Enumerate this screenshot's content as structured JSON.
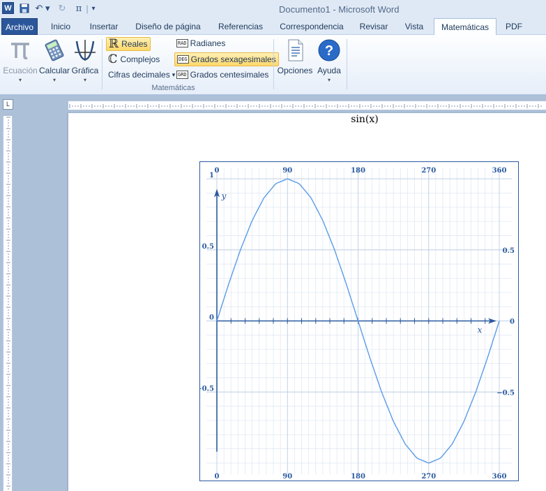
{
  "window": {
    "title": "Documento1  -  Microsoft Word"
  },
  "quick_access": {
    "word_logo": "W",
    "save_icon": "save-icon",
    "undo_glyph": "↶ ▾",
    "redo_glyph": "↻",
    "pi_glyph": "π",
    "separator": "|",
    "customize_glyph": "▾"
  },
  "tabs": [
    {
      "label": "Archivo"
    },
    {
      "label": "Inicio"
    },
    {
      "label": "Insertar"
    },
    {
      "label": "Diseño de página"
    },
    {
      "label": "Referencias"
    },
    {
      "label": "Correspondencia"
    },
    {
      "label": "Revisar"
    },
    {
      "label": "Vista"
    },
    {
      "label": "Matemáticas"
    },
    {
      "label": "PDF"
    }
  ],
  "ribbon": {
    "ecuacion": "Ecuación",
    "calcular": "Calcular",
    "grafica": "Gráfica",
    "reales": "Reales",
    "complejos": "Complejos",
    "cifras": "Cifras decimales",
    "radianes": "Radianes",
    "grados_sex": "Grados sexagesimales",
    "grados_cent": "Grados centesimales",
    "opciones": "Opciones",
    "ayuda": "Ayuda",
    "group_label": "Matemáticas",
    "badge_rad": "RAD",
    "badge_deg": "DEG",
    "badge_grd": "GRD",
    "reales_glyph": "ℝ",
    "complejos_glyph": "ℂ",
    "dropdown_glyph": "▾"
  },
  "document": {
    "equation": "sin(x)"
  },
  "ruler": {
    "corner_glyph": "L"
  },
  "colors": {
    "file_tab": "#2b579a",
    "curve": "#5a9be8",
    "axis": "#2a5aa0",
    "grid": "#dde6f2"
  },
  "chart_data": {
    "type": "line",
    "function": "sin(x)",
    "xlabel": "x",
    "ylabel": "y",
    "xlim": [
      0,
      360
    ],
    "ylim": [
      -1,
      1
    ],
    "x_ticks": [
      0,
      90,
      180,
      270,
      360
    ],
    "y_ticks": [
      1,
      0.5,
      0,
      -0.5
    ],
    "y_tick_labels_right": [
      0.5,
      0,
      -0.5
    ],
    "grid": true,
    "series": [
      {
        "x": [
          0,
          15,
          30,
          45,
          60,
          75,
          90,
          105,
          120,
          135,
          150,
          165,
          180,
          195,
          210,
          225,
          240,
          255,
          270,
          285,
          300,
          315,
          330,
          345,
          360
        ],
        "values": [
          0,
          0.259,
          0.5,
          0.707,
          0.866,
          0.966,
          1,
          0.966,
          0.866,
          0.707,
          0.5,
          0.259,
          0,
          -0.259,
          -0.5,
          -0.707,
          -0.866,
          -0.966,
          -1,
          -0.966,
          -0.866,
          -0.707,
          -0.5,
          -0.259,
          0
        ]
      }
    ]
  }
}
